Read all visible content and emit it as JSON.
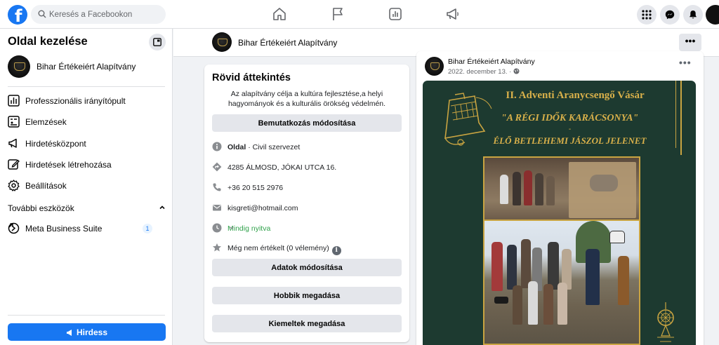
{
  "topbar": {
    "search_placeholder": "Keresés a Facebookon"
  },
  "sidebar": {
    "title": "Oldal kezelése",
    "page_name": "Bihar Értékeiért Alapítvány",
    "items": [
      {
        "label": "Professzionális irányítópult",
        "icon": "dashboard-icon"
      },
      {
        "label": "Elemzések",
        "icon": "insights-icon"
      },
      {
        "label": "Hirdetésközpont",
        "icon": "megaphone-icon"
      },
      {
        "label": "Hirdetések létrehozása",
        "icon": "edit-icon"
      },
      {
        "label": "Beállítások",
        "icon": "gear-icon"
      }
    ],
    "more_tools_label": "További eszközök",
    "meta_business_suite": {
      "label": "Meta Business Suite",
      "badge": "1"
    },
    "promote_label": "Hirdess"
  },
  "page_header": {
    "name": "Bihar Értékeiért Alapítvány",
    "more": "•••"
  },
  "about": {
    "title": "Rövid áttekintés",
    "description": "Az alapítvány célja a kultúra fejlesztése,a helyi hagyományok és a kulturális örökség védelmén.",
    "edit_intro_button": "Bemutatkozás módosítása",
    "page_label": "Oldal",
    "category": "· Civil szervezet",
    "address": "4285 ÁLMOSD, JÓKAI UTCA 16.",
    "phone": "+36 20 515 2976",
    "email": "kisgreti@hotmail.com",
    "hours": "Mindig nyitva",
    "rating": "Még nem értékelt (0 vélemény)",
    "edit_details_button": "Adatok módosítása",
    "add_hobbies_button": "Hobbik megadása",
    "add_featured_button": "Kiemeltek megadása"
  },
  "post": {
    "author": "Bihar Értékeiért Alapítvány",
    "date": "2022. december 13. ·",
    "more": "•••",
    "poster": {
      "title": "II. Adventi Aranycsengő Vásár",
      "subtitle1": "\"A RÉGI IDŐK KARÁCSONYA\"",
      "dash": "-",
      "subtitle2": "ÉLŐ BETLEHEMI JÁSZOL JELENET"
    }
  },
  "colors": {
    "facebook_blue": "#1877f2",
    "open_green": "#31a24c",
    "poster_green": "#1d3a30",
    "poster_gold": "#d8b04a"
  }
}
